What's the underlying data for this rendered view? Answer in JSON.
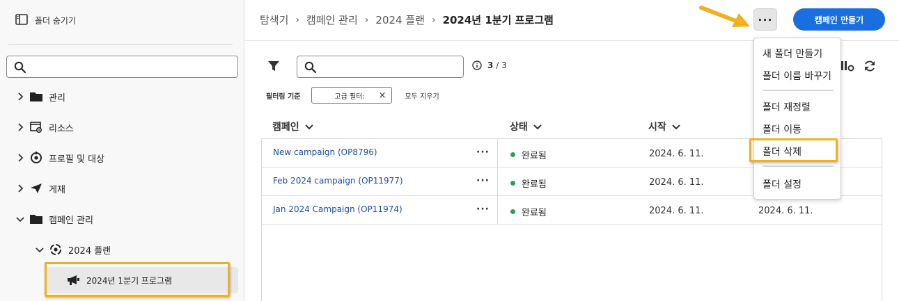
{
  "sidebar": {
    "hide_folders_label": "폴더 숨기기",
    "search_placeholder": "",
    "items": [
      {
        "label": "관리",
        "icon": "folder-icon"
      },
      {
        "label": "리소스",
        "icon": "resources-icon"
      },
      {
        "label": "프로필 및 대상",
        "icon": "profiles-icon"
      },
      {
        "label": "게재",
        "icon": "send-icon"
      },
      {
        "label": "캠페인 관리",
        "icon": "folder-icon"
      },
      {
        "label": "2024 플랜",
        "icon": "plan-icon"
      },
      {
        "label": "2024년 1분기 프로그램",
        "icon": "megaphone-icon"
      }
    ]
  },
  "header": {
    "breadcrumb": [
      "탐색기",
      "캠페인 관리",
      "2024 플랜"
    ],
    "current": "2024년 1분기 프로그램",
    "more_label": "···",
    "create_label": "캠페인 만들기"
  },
  "toolbar": {
    "search_placeholder": "",
    "count_current": "3",
    "count_sep": "/",
    "count_total": "3",
    "filter_label": "필터링 기준",
    "chip_label": "고급 필터:",
    "chip_close": "×",
    "clear_all": "모두 지우기"
  },
  "table": {
    "columns": [
      "캠페인",
      "상태",
      "시작"
    ],
    "rows": [
      {
        "name": "New campaign (OP8796)",
        "status": "완료됨",
        "start": "2024. 6. 11.",
        "end": ""
      },
      {
        "name": "Feb 2024 campaign (OP11977)",
        "status": "완료됨",
        "start": "2024. 6. 11.",
        "end": ""
      },
      {
        "name": "Jan 2024 Campaign (OP11974)",
        "status": "완료됨",
        "start": "2024. 6. 11.",
        "end": "2024. 6. 11."
      }
    ],
    "row_menu": "···"
  },
  "menu": {
    "items": [
      "새 폴더 만들기",
      "폴더 이름 바꾸기",
      "폴더 재정렬",
      "폴더 이동",
      "폴더 삭제",
      "폴더 설정"
    ]
  },
  "colors": {
    "accent": "#1a6fe0",
    "highlight": "#f0b21b",
    "status_green": "#2d9d5c",
    "link": "#1a4fa0"
  }
}
